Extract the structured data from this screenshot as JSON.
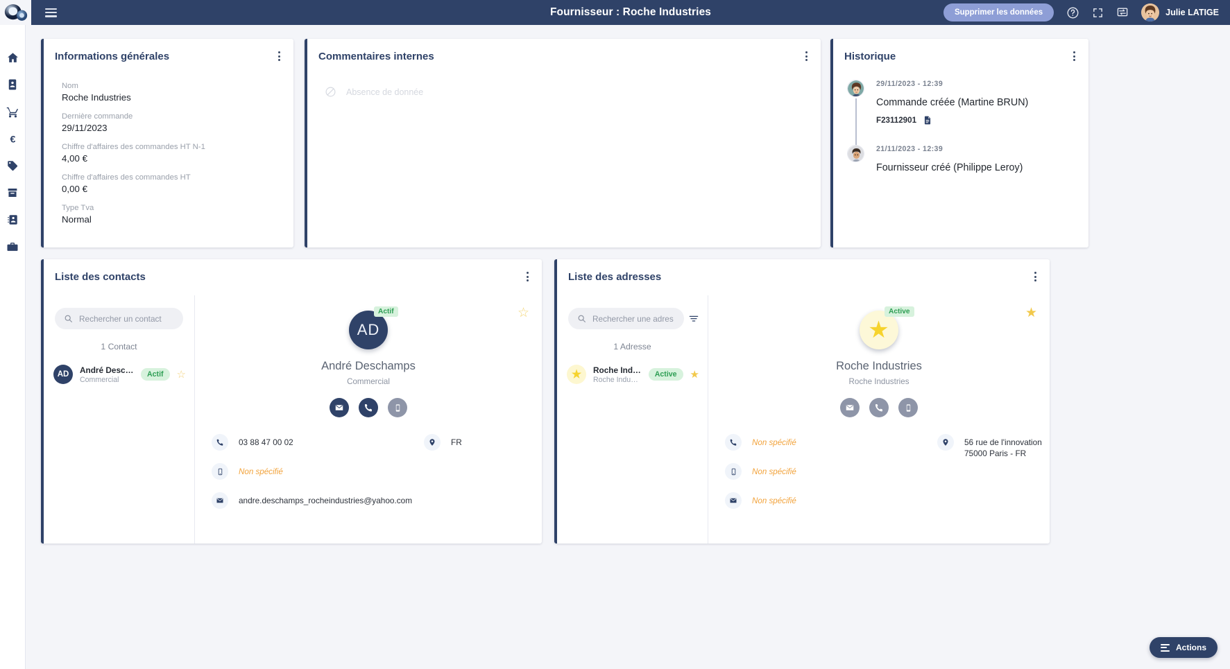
{
  "topbar": {
    "title": "Fournisseur : Roche Industries",
    "delete_label": "Supprimer les données",
    "help_icon": "help-circle-icon",
    "fullscreen_icon": "fullscreen-icon",
    "chat_icon": "message-icon",
    "user_name": "Julie LATIGE"
  },
  "rail": {
    "items": [
      {
        "icon": "home-icon"
      },
      {
        "icon": "contact-card-icon"
      },
      {
        "icon": "cart-icon"
      },
      {
        "icon": "euro-icon"
      },
      {
        "icon": "tag-icon"
      },
      {
        "icon": "archive-icon"
      },
      {
        "icon": "address-book-icon"
      },
      {
        "icon": "toolbox-icon"
      }
    ]
  },
  "general_info": {
    "title": "Informations générales",
    "fields": [
      {
        "label": "Nom",
        "value": "Roche Industries"
      },
      {
        "label": "Dernière commande",
        "value": "29/11/2023"
      },
      {
        "label": "Chiffre d'affaires des commandes HT N-1",
        "value": "4,00 €"
      },
      {
        "label": "Chiffre d'affaires des commandes HT",
        "value": "0,00 €"
      },
      {
        "label": "Type Tva",
        "value": "Normal"
      }
    ]
  },
  "comments": {
    "title": "Commentaires internes",
    "empty_text": "Absence de donnée",
    "empty_icon": "no-data-icon"
  },
  "history": {
    "title": "Historique",
    "entries": [
      {
        "date": "29/11/2023 - 12:39",
        "text": "Commande créée (Martine BRUN)",
        "reference": "F23112901",
        "doc_icon": "document-icon"
      },
      {
        "date": "21/11/2023 - 12:39",
        "text": "Fournisseur créé (Philippe Leroy)",
        "reference": "",
        "doc_icon": ""
      }
    ]
  },
  "contacts": {
    "title": "Liste des contacts",
    "search_placeholder": "Rechercher un contact",
    "search_value": "",
    "count_label": "1 Contact",
    "items": [
      {
        "initials": "AD",
        "name": "André Deschamps",
        "subtitle": "Commercial",
        "status": "Actif"
      }
    ],
    "detail": {
      "initials": "AD",
      "status": "Actif",
      "name": "André Deschamps",
      "subtitle": "Commercial",
      "phone": "03 88 47 00 02",
      "mobile": "Non spécifié",
      "email": "andre.deschamps_rocheindustries@yahoo.com",
      "location": "FR"
    }
  },
  "addresses": {
    "title": "Liste des adresses",
    "search_placeholder": "Rechercher une adres",
    "search_value": "",
    "count_label": "1 Adresse",
    "filter_icon": "filter-icon",
    "items": [
      {
        "name": "Roche Industr...",
        "subtitle": "Roche Industries",
        "status": "Active"
      }
    ],
    "detail": {
      "status": "Active",
      "name": "Roche Industries",
      "subtitle": "Roche Industries",
      "phone": "Non spécifié",
      "mobile": "Non spécifié",
      "email": "Non spécifié",
      "address_line1": "56 rue de l'innovation",
      "address_line2": "75000 Paris - FR"
    }
  },
  "footer": {
    "actions_label": "Actions"
  },
  "colors": {
    "navy": "#2f4268",
    "green": "#2e9e54",
    "green_bg": "#d7f2dd",
    "orange": "#f2a33c",
    "star_yellow": "#f2c94c",
    "page_bg": "#f4f5f9",
    "button_blue": "#8e9ed6"
  }
}
